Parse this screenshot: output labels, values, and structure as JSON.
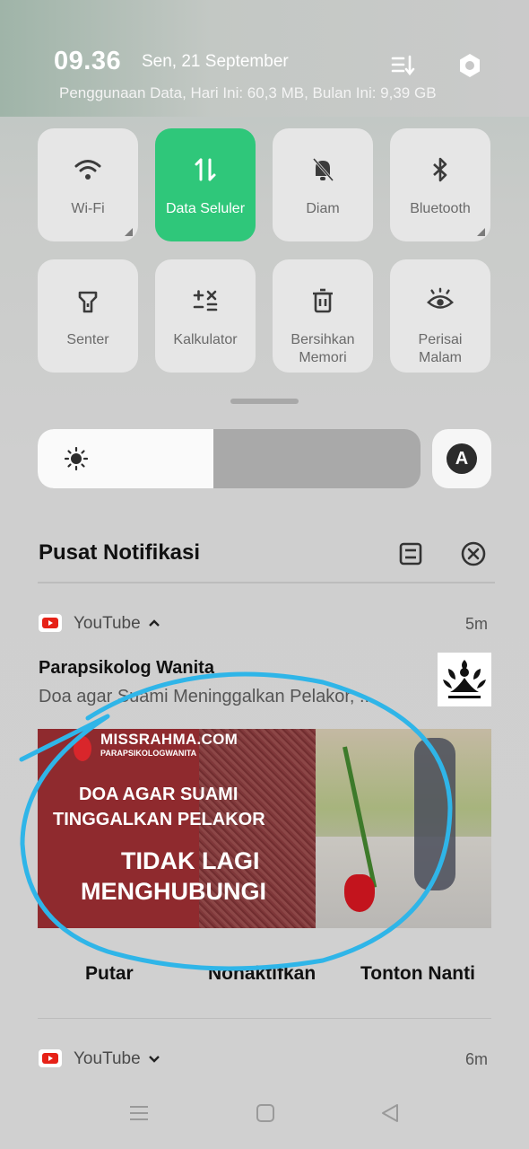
{
  "status": {
    "time": "09.36",
    "date": "Sen, 21 September",
    "data_usage": "Penggunaan Data, Hari Ini: 60,3 MB, Bulan Ini: 9,39 GB"
  },
  "header_icons": [
    "edit-list-icon",
    "settings-hex-icon"
  ],
  "quick_tiles": [
    {
      "label": "Wi-Fi",
      "icon": "wifi-icon",
      "active": false
    },
    {
      "label": "Data Seluler",
      "icon": "mobile-data-icon",
      "active": true
    },
    {
      "label": "Diam",
      "icon": "bell-off-icon",
      "active": false
    },
    {
      "label": "Bluetooth",
      "icon": "bluetooth-icon",
      "active": false
    },
    {
      "label": "Senter",
      "icon": "flashlight-icon",
      "active": false
    },
    {
      "label": "Kalkulator",
      "icon": "calculator-icon",
      "active": false
    },
    {
      "label": "Bersihkan Memori",
      "icon": "trash-icon",
      "active": false
    },
    {
      "label": "Perisai Malam",
      "icon": "eye-icon",
      "active": false
    }
  ],
  "brightness": {
    "level": 0.46,
    "auto_label": "A"
  },
  "notification_center": {
    "title": "Pusat Notifikasi"
  },
  "notifications": [
    {
      "app": "YouTube",
      "age": "5m",
      "expanded": true,
      "title": "Parapsikolog Wanita",
      "body": "Doa agar Suami Meninggalkan Pelakor, ..",
      "thumbnail": {
        "brand": "MISSRAHMA.COM",
        "brand_sub": "PARAPSIKOLOGWANITA",
        "line1": "DOA AGAR SUAMI",
        "line2": "TINGGALKAN PELAKOR",
        "line3": "TIDAK LAGI",
        "line4": "MENGHUBUNGI"
      },
      "actions": [
        "Putar",
        "Nonaktifkan",
        "Tonton Nanti"
      ]
    },
    {
      "app": "YouTube",
      "age": "6m",
      "expanded": false
    }
  ],
  "accent_colors": {
    "active_tile": "#2fc77a",
    "youtube_red": "#e62117",
    "scribble": "#2fb5e8"
  }
}
